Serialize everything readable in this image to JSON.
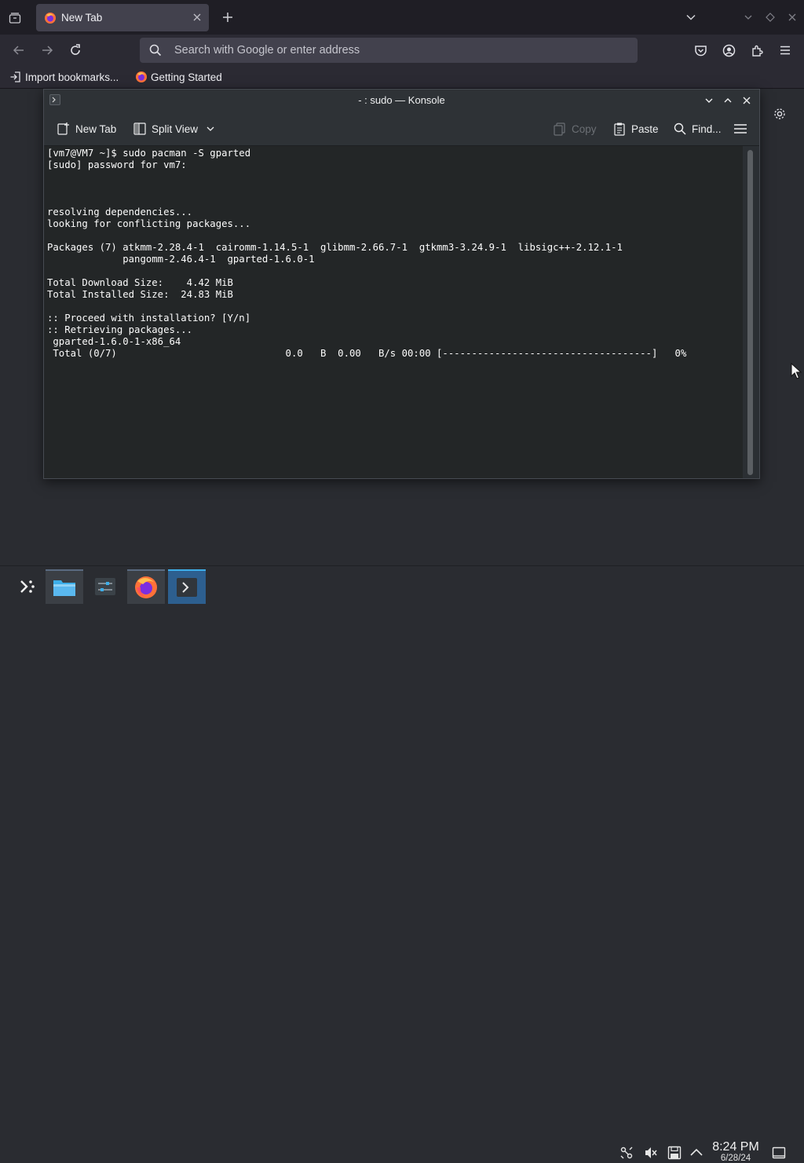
{
  "browser": {
    "tab": {
      "title": "New Tab"
    },
    "urlbar": {
      "placeholder": "Search with Google or enter address"
    },
    "bookmarks": [
      {
        "label": "Import bookmarks..."
      },
      {
        "label": "Getting Started"
      }
    ]
  },
  "konsole": {
    "title": "- : sudo — Konsole",
    "toolbar": {
      "new_tab": "New Tab",
      "split_view": "Split View",
      "copy": "Copy",
      "paste": "Paste",
      "find": "Find..."
    },
    "terminal_text": "[vm7@VM7 ~]$ sudo pacman -S gparted\n[sudo] password for vm7:\n\n\n\nresolving dependencies...\nlooking for conflicting packages...\n\nPackages (7) atkmm-2.28.4-1  cairomm-1.14.5-1  glibmm-2.66.7-1  gtkmm3-3.24.9-1  libsigc++-2.12.1-1\n             pangomm-2.46.4-1  gparted-1.6.0-1\n\nTotal Download Size:    4.42 MiB\nTotal Installed Size:  24.83 MiB\n\n:: Proceed with installation? [Y/n]\n:: Retrieving packages...\n gparted-1.6.0-1-x86_64\n Total (0/7)                             0.0   B  0.00   B/s 00:00 [------------------------------------]   0%"
  },
  "taskbar": {
    "clock_time": "8:24 PM",
    "clock_date": "6/28/24",
    "apps": [
      "application-launcher-icon",
      "dolphin-file-manager-icon",
      "system-settings-icon",
      "firefox-icon",
      "konsole-icon"
    ]
  },
  "colors": {
    "accent": "#3daee9",
    "firefox_orange": "#ff7139",
    "terminal_bg": "#232627"
  }
}
